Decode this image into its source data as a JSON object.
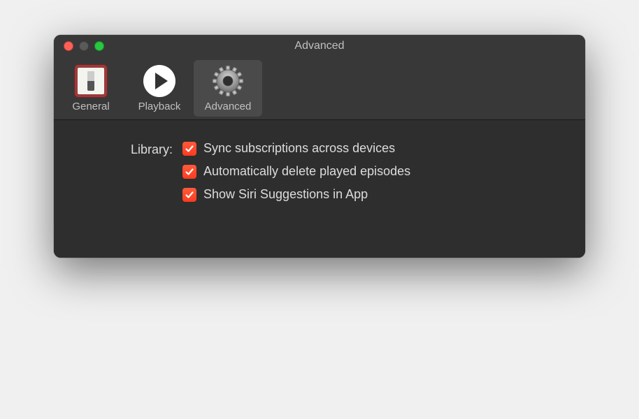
{
  "window": {
    "title": "Advanced"
  },
  "tabs": {
    "general": {
      "label": "General"
    },
    "playback": {
      "label": "Playback"
    },
    "advanced": {
      "label": "Advanced"
    }
  },
  "section": {
    "label": "Library:"
  },
  "options": {
    "sync": {
      "label": "Sync subscriptions across devices",
      "checked": true
    },
    "autodelete": {
      "label": "Automatically delete played episodes",
      "checked": true
    },
    "siri": {
      "label": "Show Siri Suggestions in App",
      "checked": true
    }
  }
}
